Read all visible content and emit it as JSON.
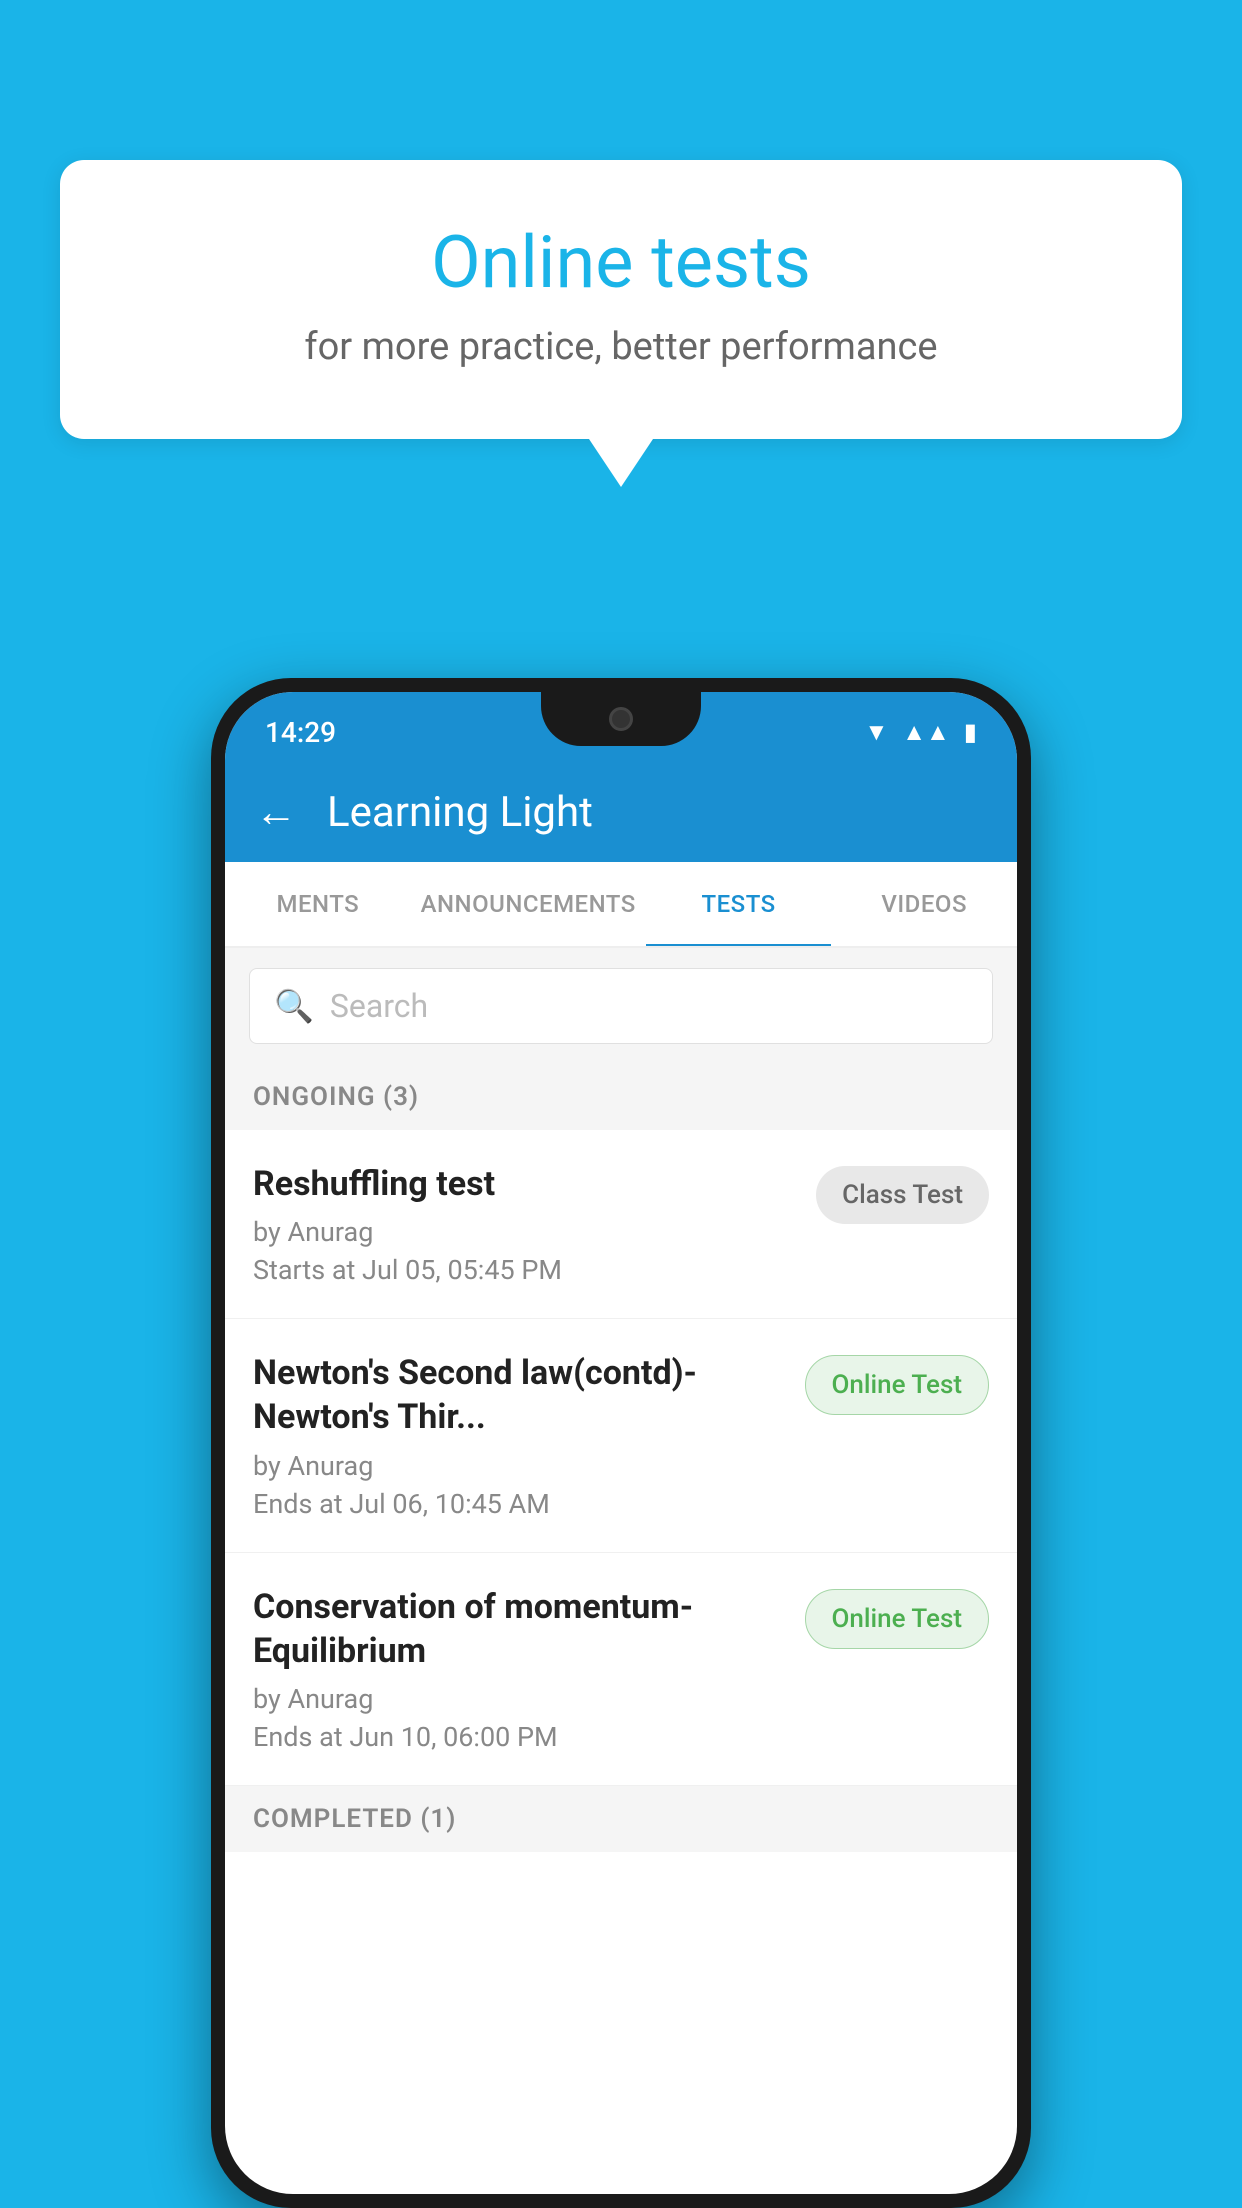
{
  "background_color": "#1ab4e8",
  "speech_bubble": {
    "title": "Online tests",
    "subtitle": "for more practice, better performance"
  },
  "status_bar": {
    "time": "14:29",
    "icons": [
      "wifi",
      "signal",
      "battery"
    ]
  },
  "app_header": {
    "title": "Learning Light",
    "back_label": "←"
  },
  "tabs": [
    {
      "label": "MENTS",
      "active": false
    },
    {
      "label": "ANNOUNCEMENTS",
      "active": false
    },
    {
      "label": "TESTS",
      "active": true
    },
    {
      "label": "VIDEOS",
      "active": false
    }
  ],
  "search": {
    "placeholder": "Search"
  },
  "ongoing_section": {
    "label": "ONGOING (3)"
  },
  "test_items": [
    {
      "title": "Reshuffling test",
      "author": "by Anurag",
      "time": "Starts at  Jul 05, 05:45 PM",
      "badge": "Class Test",
      "badge_type": "class"
    },
    {
      "title": "Newton's Second law(contd)-Newton's Thir...",
      "author": "by Anurag",
      "time": "Ends at  Jul 06, 10:45 AM",
      "badge": "Online Test",
      "badge_type": "online"
    },
    {
      "title": "Conservation of momentum-Equilibrium",
      "author": "by Anurag",
      "time": "Ends at  Jun 10, 06:00 PM",
      "badge": "Online Test",
      "badge_type": "online"
    }
  ],
  "completed_section": {
    "label": "COMPLETED (1)"
  }
}
